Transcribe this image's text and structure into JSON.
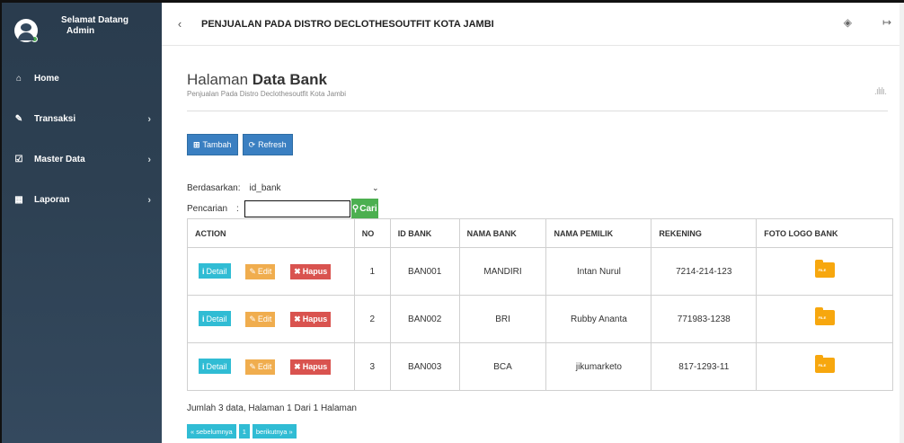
{
  "sidebar": {
    "user": {
      "line1": "Selamat Datang",
      "line2": "Admin"
    },
    "items": [
      {
        "label": "Home",
        "icon": "home-icon",
        "has_children": false
      },
      {
        "label": "Transaksi",
        "icon": "pencil-icon",
        "has_children": true
      },
      {
        "label": "Master Data",
        "icon": "edit-icon",
        "has_children": true
      },
      {
        "label": "Laporan",
        "icon": "calendar-icon",
        "has_children": true
      }
    ]
  },
  "topbar": {
    "title": "PENJUALAN PADA DISTRO DECLOTHESOUTFIT KOTA JAMBI",
    "icons": [
      "paint-bucket-icon",
      "logout-icon"
    ]
  },
  "page": {
    "title_light": "Halaman",
    "title_bold": "Data Bank",
    "subtitle": "Penjualan Pada Distro Declothesoutfit Kota Jambi"
  },
  "buttons": {
    "add": "Tambah",
    "refresh": "Refresh"
  },
  "filter": {
    "by_label": "Berdasarkan:",
    "by_value": "id_bank",
    "search_label": "Pencarian",
    "search_value": "",
    "search_button": "Cari"
  },
  "table": {
    "headers": [
      "ACTION",
      "NO",
      "ID BANK",
      "NAMA BANK",
      "NAMA PEMILIK",
      "REKENING",
      "FOTO LOGO BANK"
    ],
    "action_labels": {
      "detail": "Detail",
      "edit": "Edit",
      "hapus": "Hapus"
    },
    "file_icon_text": "FILE",
    "rows": [
      {
        "no": "1",
        "id_bank": "BAN001",
        "nama_bank": "MANDIRI",
        "nama_pemilik": "Intan Nurul",
        "rekening": "7214-214-123"
      },
      {
        "no": "2",
        "id_bank": "BAN002",
        "nama_bank": "BRI",
        "nama_pemilik": "Rubby Ananta",
        "rekening": "771983-1238"
      },
      {
        "no": "3",
        "id_bank": "BAN003",
        "nama_bank": "BCA",
        "nama_pemilik": "jikumarketo",
        "rekening": "817-1293-11"
      }
    ]
  },
  "footer": {
    "info": "Jumlah 3 data, Halaman 1 Dari 1 Halaman",
    "prev": "« sebelumnya",
    "page": "1",
    "next": "berikutnya »"
  }
}
